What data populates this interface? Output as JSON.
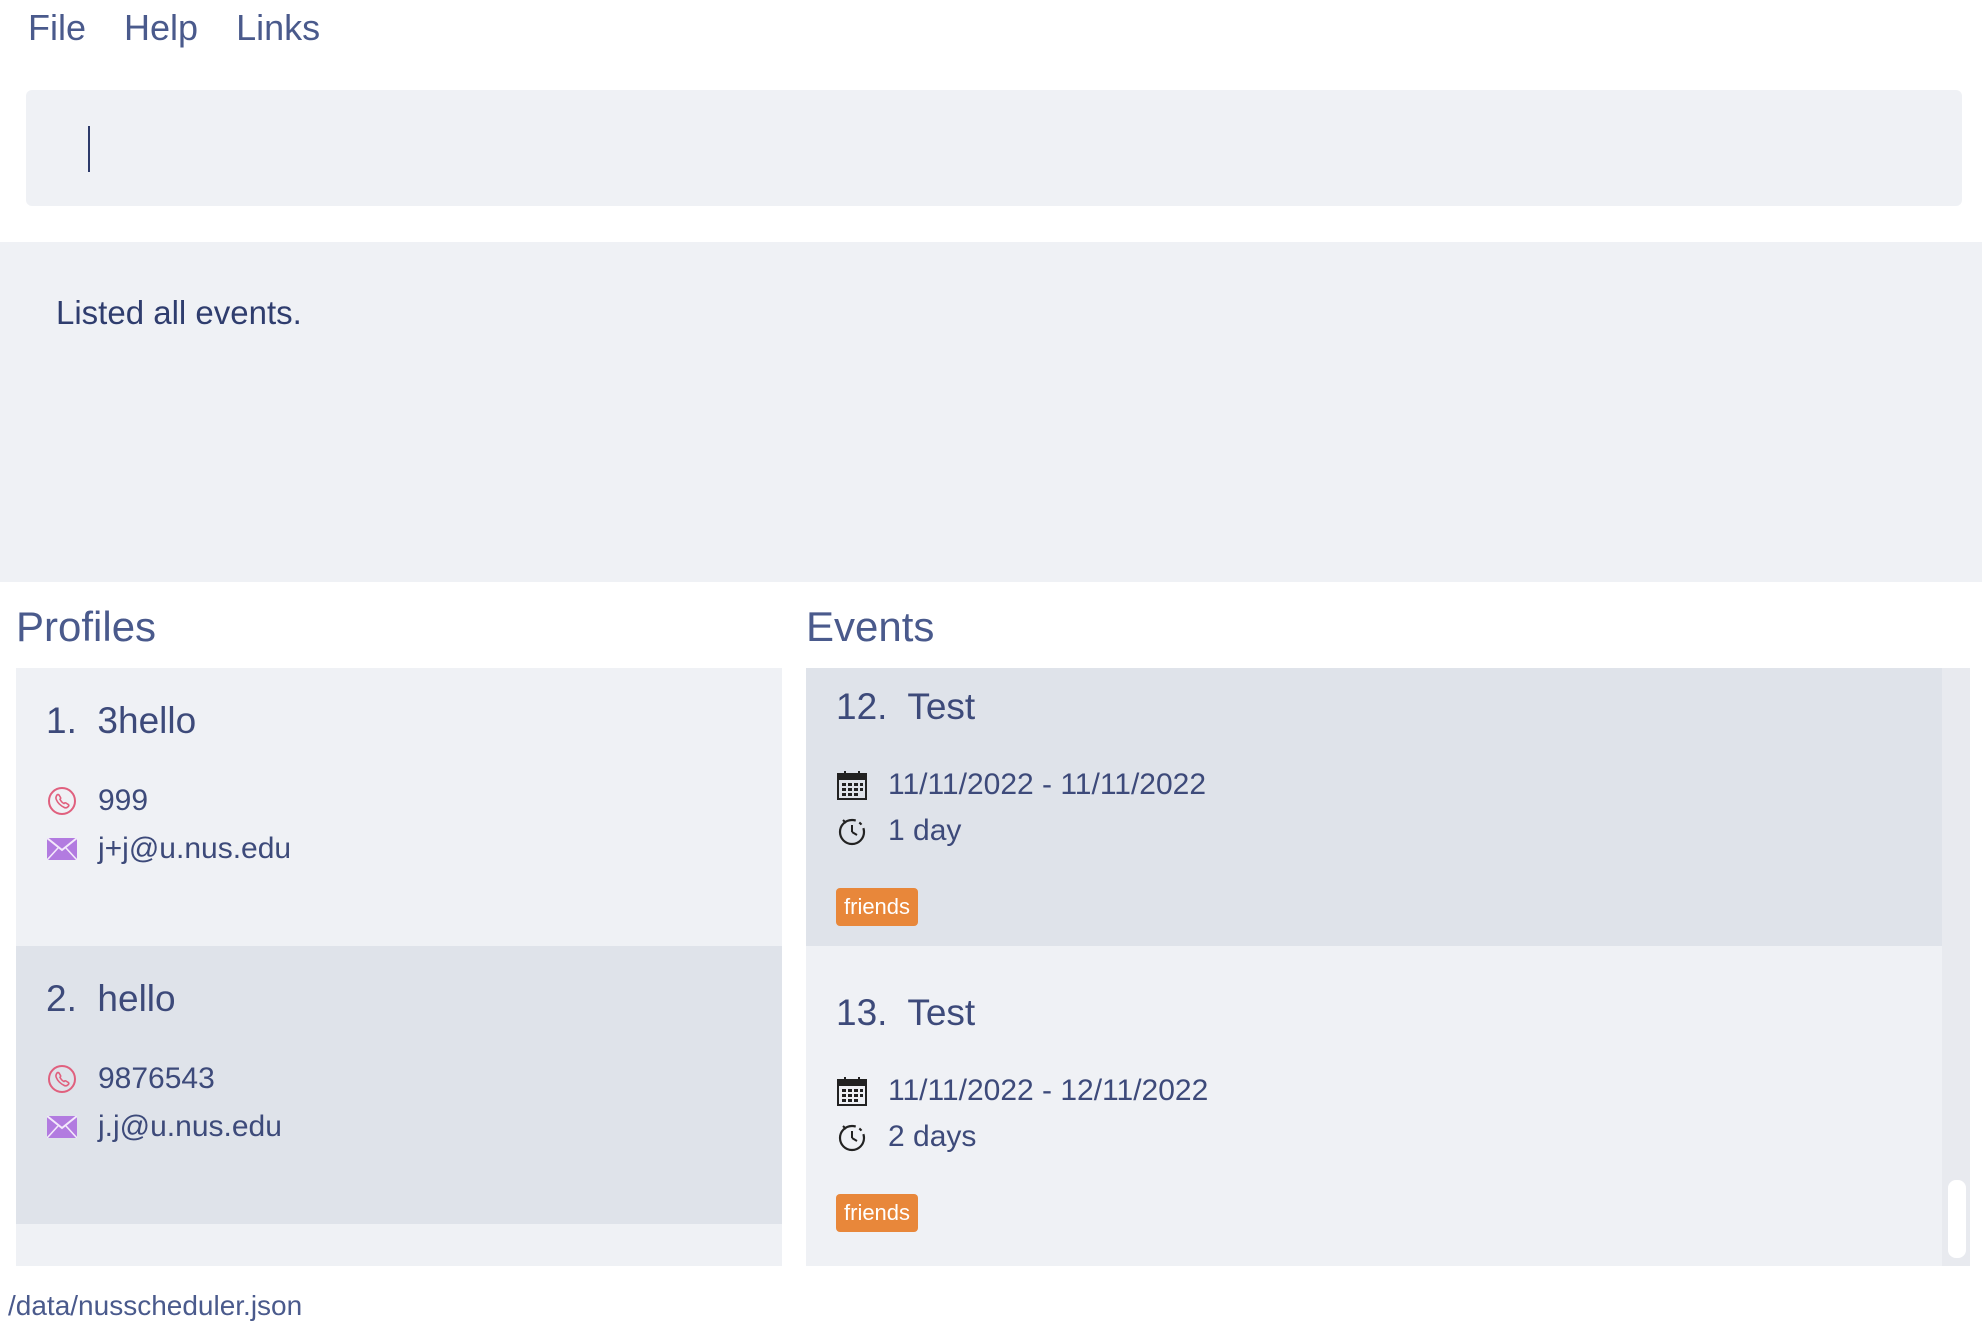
{
  "menu": {
    "file": "File",
    "help": "Help",
    "links": "Links"
  },
  "command": {
    "value": "",
    "placeholder": ""
  },
  "result": {
    "message": "Listed all events."
  },
  "profiles": {
    "title": "Profiles",
    "items": [
      {
        "index": "1.",
        "name": "3hello",
        "phone": "999",
        "email": "j+j@u.nus.edu"
      },
      {
        "index": "2.",
        "name": "hello",
        "phone": "9876543",
        "email": "j.j@u.nus.edu"
      }
    ]
  },
  "events": {
    "title": "Events",
    "items": [
      {
        "index": "12.",
        "name": "Test",
        "dates": "11/11/2022 - 11/11/2022",
        "duration": "1 day",
        "tag": "friends"
      },
      {
        "index": "13.",
        "name": "Test",
        "dates": "11/11/2022 - 12/11/2022",
        "duration": "2 days",
        "tag": "friends"
      }
    ]
  },
  "status": {
    "path": "/data/nusscheduler.json"
  },
  "colors": {
    "accent": "#e8873a",
    "phone_icon": "#e0607e",
    "email_icon": "#b27be0",
    "text": "#3d4a7a"
  },
  "icons": {
    "phone": "phone-icon",
    "email": "email-icon",
    "calendar": "calendar-icon",
    "clock": "clock-icon"
  }
}
